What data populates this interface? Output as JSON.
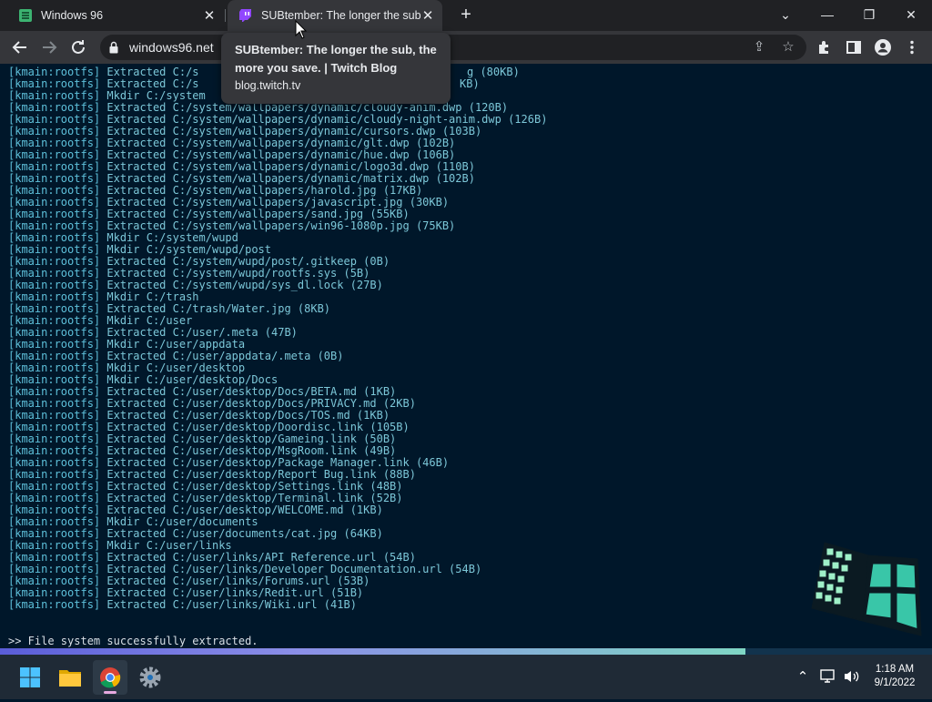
{
  "browser": {
    "tabs": [
      {
        "title": "Windows 96",
        "active": false
      },
      {
        "title": "SUBtember: The longer the sub, t",
        "active": true
      }
    ],
    "address": "windows96.net",
    "tooltip": {
      "title": "SUBtember: The longer the sub, the more you save. | Twitch Blog",
      "domain": "blog.twitch.tv"
    },
    "icons": {
      "back": "arrow-left-icon",
      "forward": "arrow-right-icon",
      "reload": "reload-icon",
      "lock": "lock-icon",
      "share": "share-icon",
      "bookmark": "star-icon",
      "extensions": "puzzle-icon",
      "side_panel": "side-panel-icon",
      "profile": "person-icon",
      "menu": "kebab-menu-icon"
    }
  },
  "terminal": {
    "lines": [
      {
        "tag": "[kmain:rootfs]",
        "text": " Extracted C:/system/wallpapers/dynamic/cloudy-anim.dwp (120B)"
      },
      {
        "tag": "[kmain:rootfs]",
        "text": " Extracted C:/system/wallpapers/dynamic/cloudy-night-anim.dwp (126B)"
      },
      {
        "tag": "[kmain:rootfs]",
        "text": " Extracted C:/system/wallpapers/dynamic/cursors.dwp (103B)"
      },
      {
        "tag": "[kmain:rootfs]",
        "text": " Extracted C:/system/wallpapers/dynamic/glt.dwp (102B)"
      },
      {
        "tag": "[kmain:rootfs]",
        "text": " Extracted C:/system/wallpapers/dynamic/hue.dwp (106B)"
      },
      {
        "tag": "[kmain:rootfs]",
        "text": " Extracted C:/system/wallpapers/dynamic/logo3d.dwp (110B)"
      },
      {
        "tag": "[kmain:rootfs]",
        "text": " Extracted C:/system/wallpapers/dynamic/matrix.dwp (102B)"
      },
      {
        "tag": "[kmain:rootfs]",
        "text": " Extracted C:/system/wallpapers/harold.jpg (17KB)"
      },
      {
        "tag": "[kmain:rootfs]",
        "text": " Extracted C:/system/wallpapers/javascript.jpg (30KB)"
      },
      {
        "tag": "[kmain:rootfs]",
        "text": " Extracted C:/system/wallpapers/sand.jpg (55KB)"
      },
      {
        "tag": "[kmain:rootfs]",
        "text": " Extracted C:/system/wallpapers/win96-1080p.jpg (75KB)"
      },
      {
        "tag": "[kmain:rootfs]",
        "text": " Mkdir C:/system/wupd"
      },
      {
        "tag": "[kmain:rootfs]",
        "text": " Mkdir C:/system/wupd/post"
      },
      {
        "tag": "[kmain:rootfs]",
        "text": " Extracted C:/system/wupd/post/.gitkeep (0B)"
      },
      {
        "tag": "[kmain:rootfs]",
        "text": " Extracted C:/system/wupd/rootfs.sys (5B)"
      },
      {
        "tag": "[kmain:rootfs]",
        "text": " Extracted C:/system/wupd/sys_dl.lock (27B)"
      },
      {
        "tag": "[kmain:rootfs]",
        "text": " Mkdir C:/trash"
      },
      {
        "tag": "[kmain:rootfs]",
        "text": " Extracted C:/trash/Water.jpg (8KB)"
      },
      {
        "tag": "[kmain:rootfs]",
        "text": " Mkdir C:/user"
      },
      {
        "tag": "[kmain:rootfs]",
        "text": " Extracted C:/user/.meta (47B)"
      },
      {
        "tag": "[kmain:rootfs]",
        "text": " Mkdir C:/user/appdata"
      },
      {
        "tag": "[kmain:rootfs]",
        "text": " Extracted C:/user/appdata/.meta (0B)"
      },
      {
        "tag": "[kmain:rootfs]",
        "text": " Mkdir C:/user/desktop"
      },
      {
        "tag": "[kmain:rootfs]",
        "text": " Mkdir C:/user/desktop/Docs"
      },
      {
        "tag": "[kmain:rootfs]",
        "text": " Extracted C:/user/desktop/Docs/BETA.md (1KB)"
      },
      {
        "tag": "[kmain:rootfs]",
        "text": " Extracted C:/user/desktop/Docs/PRIVACY.md (2KB)"
      },
      {
        "tag": "[kmain:rootfs]",
        "text": " Extracted C:/user/desktop/Docs/TOS.md (1KB)"
      },
      {
        "tag": "[kmain:rootfs]",
        "text": " Extracted C:/user/desktop/Doordisc.link (105B)"
      },
      {
        "tag": "[kmain:rootfs]",
        "text": " Extracted C:/user/desktop/Gameing.link (50B)"
      },
      {
        "tag": "[kmain:rootfs]",
        "text": " Extracted C:/user/desktop/MsgRoom.link (49B)"
      },
      {
        "tag": "[kmain:rootfs]",
        "text": " Extracted C:/user/desktop/Package Manager.link (46B)"
      },
      {
        "tag": "[kmain:rootfs]",
        "text": " Extracted C:/user/desktop/Report Bug.link (88B)"
      },
      {
        "tag": "[kmain:rootfs]",
        "text": " Extracted C:/user/desktop/Settings.link (48B)"
      },
      {
        "tag": "[kmain:rootfs]",
        "text": " Extracted C:/user/desktop/Terminal.link (52B)"
      },
      {
        "tag": "[kmain:rootfs]",
        "text": " Extracted C:/user/desktop/WELCOME.md (1KB)"
      },
      {
        "tag": "[kmain:rootfs]",
        "text": " Mkdir C:/user/documents"
      },
      {
        "tag": "[kmain:rootfs]",
        "text": " Extracted C:/user/documents/cat.jpg (64KB)"
      },
      {
        "tag": "[kmain:rootfs]",
        "text": " Mkdir C:/user/links"
      },
      {
        "tag": "[kmain:rootfs]",
        "text": " Extracted C:/user/links/API Reference.url (54B)"
      },
      {
        "tag": "[kmain:rootfs]",
        "text": " Extracted C:/user/links/Developer Documentation.url (54B)"
      },
      {
        "tag": "[kmain:rootfs]",
        "text": " Extracted C:/user/links/Forums.url (53B)"
      },
      {
        "tag": "[kmain:rootfs]",
        "text": " Extracted C:/user/links/Redit.url (51B)"
      },
      {
        "tag": "[kmain:rootfs]",
        "text": " Extracted C:/user/links/Wiki.url (41B)"
      }
    ],
    "partial_lines": [
      {
        "tag": "[kmain:rootfs]",
        "text": " Extracted C:/s",
        "tail": "g (80KB)"
      },
      {
        "tag": "[kmain:rootfs]",
        "text": " Extracted C:/s",
        "tail": "KB)"
      },
      {
        "tag": "[kmain:rootfs]",
        "text": " Mkdir C:/system",
        "tail": ""
      }
    ],
    "prompt": ">> File system successfully extracted.",
    "progress": 0.8
  },
  "taskbar": {
    "apps": [
      "start-icon",
      "file-explorer-icon",
      "chrome-icon",
      "settings-icon"
    ],
    "time": "1:18 AM",
    "date": "9/1/2022",
    "tray_icons": [
      "chevron-up-icon",
      "network-icon",
      "volume-icon"
    ]
  },
  "colors": {
    "terminal_bg": "#00172a",
    "terminal_text": "#7cc7d8",
    "taskbar_bg": "#1f2a36",
    "chrome_dark": "#202124"
  }
}
